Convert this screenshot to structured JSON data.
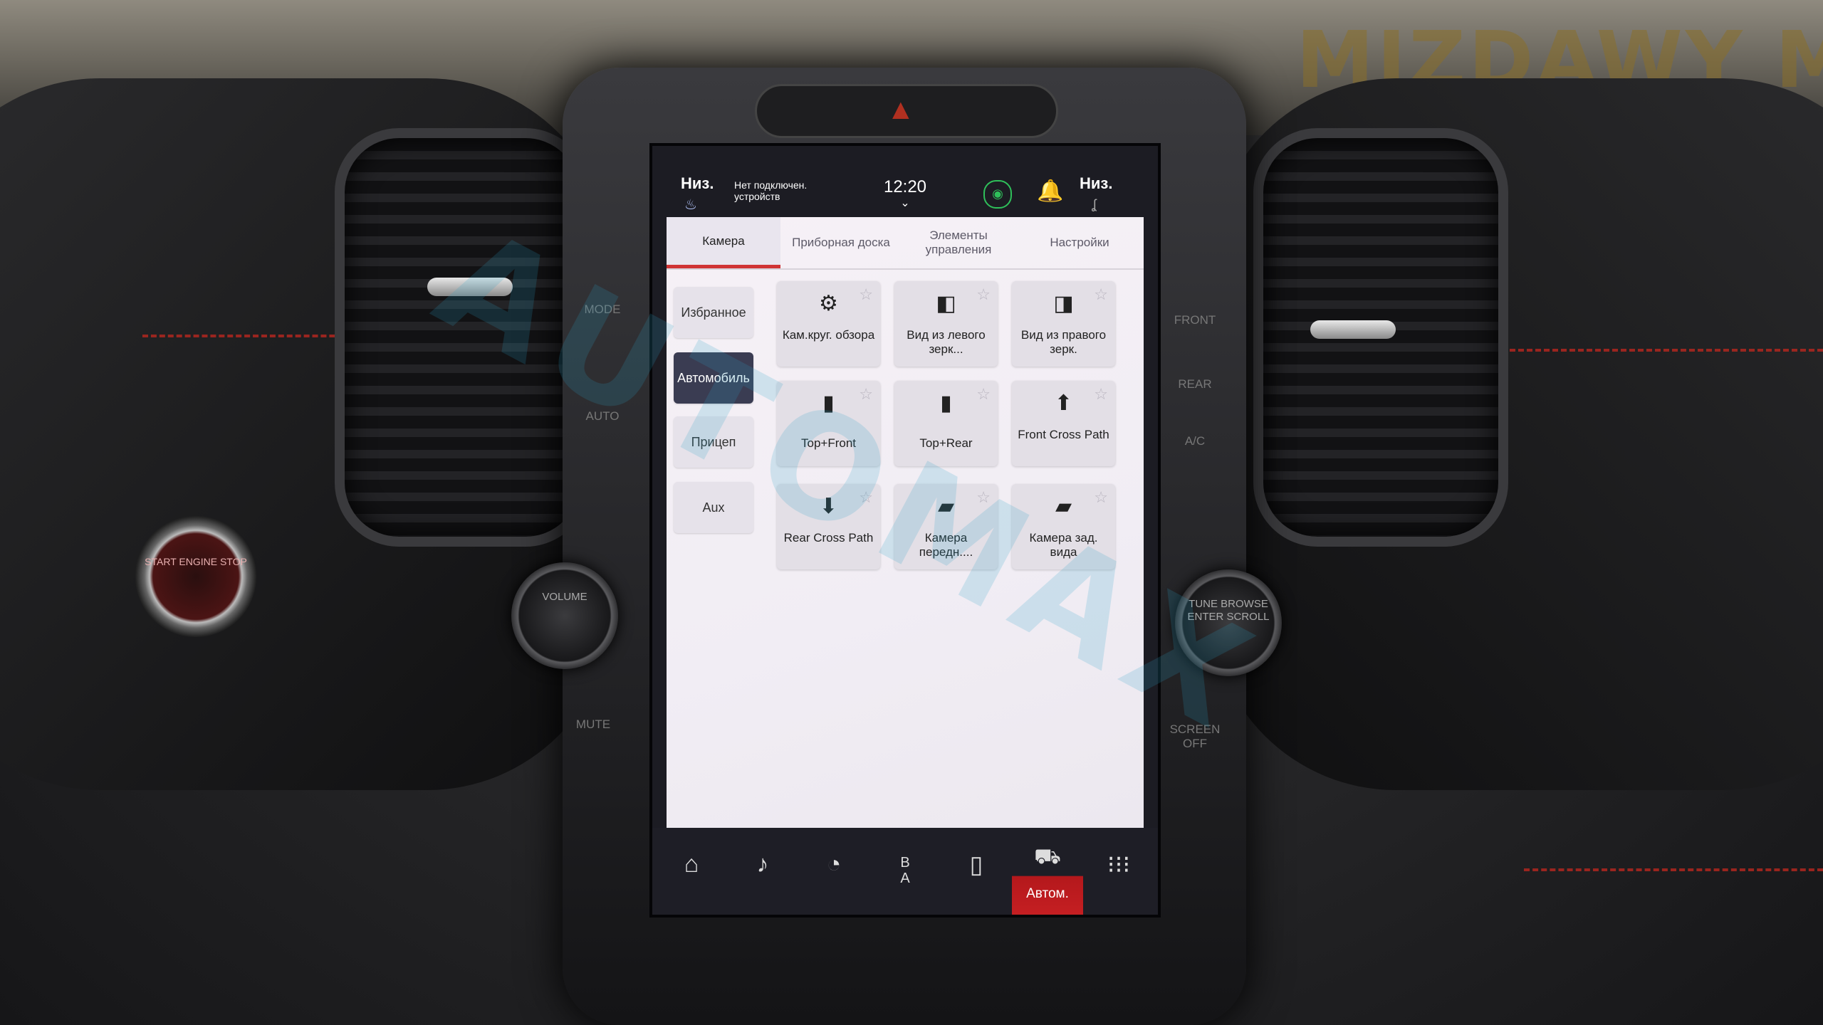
{
  "background": {
    "dealership_sign": "MIZDAWY MOTOR",
    "left_controls": [
      "MODE",
      "AUTO"
    ],
    "right_controls": [
      "FRONT",
      "REAR",
      "A/C"
    ],
    "start_button": "START ENGINE STOP",
    "volume_knob": "VOLUME",
    "tune_knob": "TUNE BROWSE ENTER SCROLL",
    "mute_label": "MUTE",
    "screen_off_label": "SCREEN OFF",
    "watermark": "AUTOMAX"
  },
  "status_bar": {
    "left_fan_label": "Низ.",
    "connection_text": "Нет подключен. устройств",
    "time": "12:20",
    "right_fan_label": "Низ."
  },
  "tabs": [
    {
      "label": "Камера",
      "active": true
    },
    {
      "label": "Приборная доска",
      "active": false
    },
    {
      "label": "Элементы управления",
      "active": false
    },
    {
      "label": "Настройки",
      "active": false
    }
  ],
  "categories": [
    {
      "label": "Избранное",
      "selected": false
    },
    {
      "label": "Автомобиль",
      "selected": true
    },
    {
      "label": "Прицеп",
      "selected": false
    },
    {
      "label": "Aux",
      "selected": false
    }
  ],
  "tiles": [
    {
      "label": "Кам.круг. обзора",
      "icon": "360-camera-icon"
    },
    {
      "label": "Вид из левого зерк...",
      "icon": "left-mirror-icon"
    },
    {
      "label": "Вид из правого зерк.",
      "icon": "right-mirror-icon"
    },
    {
      "label": "Top+Front",
      "icon": "top-front-icon"
    },
    {
      "label": "Top+Rear",
      "icon": "top-rear-icon"
    },
    {
      "label": "Front Cross Path",
      "icon": "front-cross-path-icon"
    },
    {
      "label": "Rear Cross Path",
      "icon": "rear-cross-path-icon"
    },
    {
      "label": "Камера передн....",
      "icon": "front-camera-icon"
    },
    {
      "label": "Камера зад. вида",
      "icon": "rear-camera-icon"
    }
  ],
  "nav_bar": {
    "items": [
      {
        "icon": "home-icon",
        "label": ""
      },
      {
        "icon": "music-icon",
        "label": ""
      },
      {
        "icon": "performance-icon",
        "label": ""
      },
      {
        "icon": "climate-icon",
        "label": ""
      },
      {
        "icon": "phone-icon",
        "label": ""
      },
      {
        "icon": "vehicle-icon",
        "label": "Автом."
      },
      {
        "icon": "apps-icon",
        "label": ""
      }
    ],
    "active_index": 5,
    "active_color": "#c51f22"
  }
}
